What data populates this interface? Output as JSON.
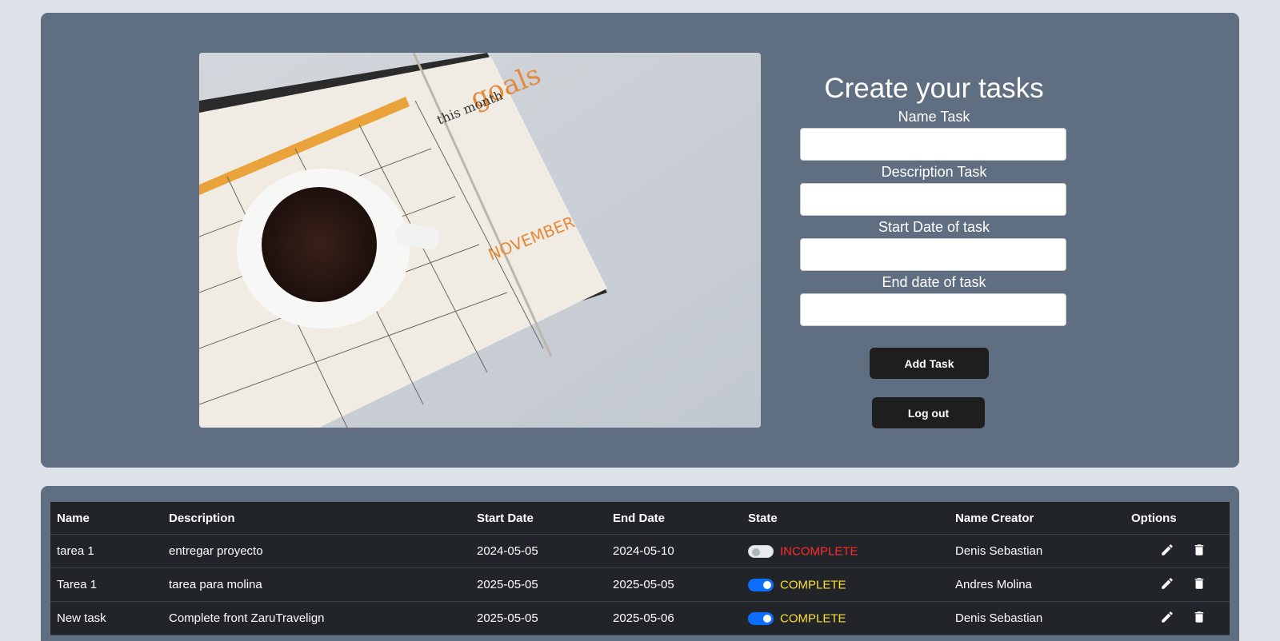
{
  "form": {
    "title": "Create your tasks",
    "fields": [
      {
        "label": "Name Task",
        "value": ""
      },
      {
        "label": "Description Task",
        "value": ""
      },
      {
        "label": "Start Date of task",
        "value": ""
      },
      {
        "label": "End date of task",
        "value": ""
      }
    ],
    "add_button": "Add Task",
    "logout_button": "Log out"
  },
  "hero_image": {
    "icon": "planner-with-coffee-image"
  },
  "table": {
    "headers": [
      "Name",
      "Description",
      "Start Date",
      "End Date",
      "State",
      "Name Creator",
      "Options"
    ],
    "rows": [
      {
        "name": "tarea 1",
        "description": "entregar proyecto",
        "start": "2024-05-05",
        "end": "2024-05-10",
        "state": "INCOMPLETE",
        "toggle_on": false,
        "creator": "Denis Sebastian"
      },
      {
        "name": "Tarea 1",
        "description": "tarea para molina",
        "start": "2025-05-05",
        "end": "2025-05-05",
        "state": "COMPLETE",
        "toggle_on": true,
        "creator": "Andres Molina"
      },
      {
        "name": "New task",
        "description": "Complete front ZaruTravelign",
        "start": "2025-05-05",
        "end": "2025-05-06",
        "state": "COMPLETE",
        "toggle_on": true,
        "creator": "Denis Sebastian"
      }
    ],
    "option_icons": [
      "pencil-icon",
      "trash-icon"
    ]
  },
  "colors": {
    "panel": "#606e82",
    "background": "#dde1e8",
    "table": "#212529",
    "incomplete": "#ff2a2a",
    "complete": "#ffdf2e",
    "toggle_on": "#0d6efd"
  }
}
